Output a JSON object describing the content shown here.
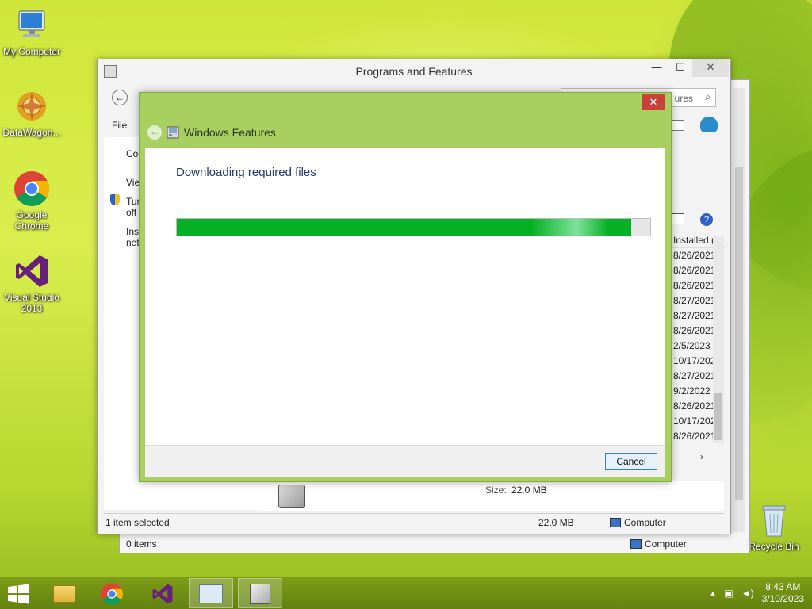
{
  "desktop": {
    "icons": [
      {
        "label": "My Computer"
      },
      {
        "label": "DataWagon..."
      },
      {
        "label": "Google Chrome"
      },
      {
        "label": "Visual Studio 2013"
      },
      {
        "label": "Recycle Bin"
      }
    ]
  },
  "programs_window": {
    "title": "Programs and Features",
    "search_fragment": "ures",
    "menu_file": "File",
    "left_fragments": [
      "Co",
      "Vie",
      "Tur",
      "off",
      "Inst",
      "net"
    ],
    "column_header": "Installed (",
    "installed_dates": [
      "8/26/2021",
      "8/26/2021",
      "8/26/2021",
      "8/27/2021",
      "8/27/2021",
      "8/26/2021",
      "2/5/2023",
      "10/17/2022",
      "8/27/2021",
      "9/2/2022",
      "8/26/2021",
      "10/17/2022",
      "8/26/2021"
    ],
    "details_size_label": "Size:",
    "details_size_value": "22.0 MB",
    "status_selected": "1 item selected",
    "status_size": "22.0 MB",
    "status_location": "Computer",
    "colors": {
      "frame": "#f3f3f3",
      "close": "#c7413a"
    }
  },
  "explorer_window": {
    "status_items": "0 items",
    "status_location": "Computer"
  },
  "windows_features_dialog": {
    "title": "Windows Features",
    "status_text": "Downloading required files",
    "progress_percent": 96,
    "cancel_label": "Cancel",
    "colors": {
      "frame": "#a8d060",
      "progress": "#06b025",
      "close": "#c7413a"
    }
  },
  "taskbar": {
    "apps": [
      "File Explorer",
      "Google Chrome",
      "Visual Studio",
      "Control Panel",
      "Windows Features"
    ],
    "clock_time": "8:43 AM",
    "clock_date": "3/10/2023",
    "tray_arrow": "▲"
  }
}
